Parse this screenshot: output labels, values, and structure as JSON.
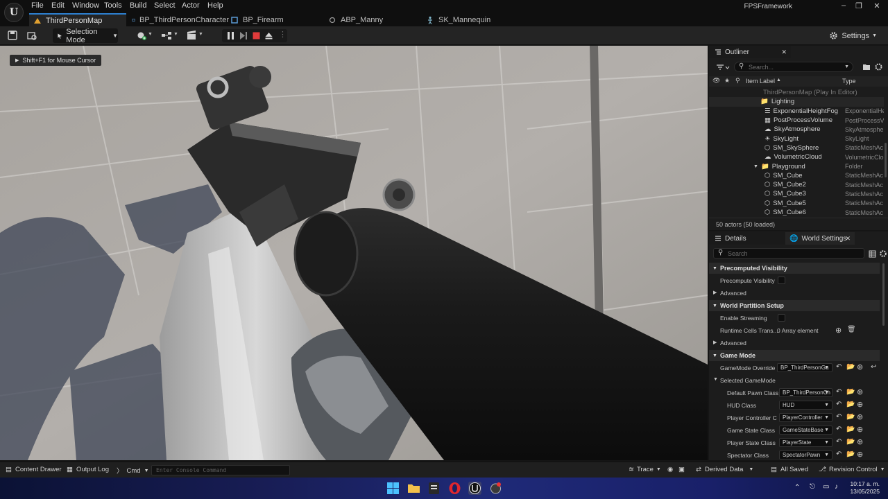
{
  "menu": [
    "File",
    "Edit",
    "Window",
    "Tools",
    "Build",
    "Select",
    "Actor",
    "Help"
  ],
  "tabs": [
    {
      "label": "ThirdPersonMap"
    },
    {
      "label": "BP_ThirdPersonCharacter"
    },
    {
      "label": "BP_Firearm"
    },
    {
      "label": "ABP_Manny"
    },
    {
      "label": "SK_Mannequin"
    }
  ],
  "project_name": "FPSFramework",
  "toolbar": {
    "selection_mode": "Selection Mode",
    "settings": "Settings"
  },
  "viewport": {
    "hint": "Shift+F1 for Mouse Cursor"
  },
  "outliner": {
    "title": "Outliner",
    "search_placeholder": "Search...",
    "col_label": "Item Label",
    "col_type": "Type",
    "map_row": "ThirdPersonMap (Play In Editor)",
    "rows": [
      {
        "label": "Lighting",
        "type": ""
      },
      {
        "label": "ExponentialHeightFog",
        "type": "ExponentialHe"
      },
      {
        "label": "PostProcessVolume",
        "type": "PostProcessV"
      },
      {
        "label": "SkyAtmosphere",
        "type": "SkyAtmosphe"
      },
      {
        "label": "SkyLight",
        "type": "SkyLight"
      },
      {
        "label": "SM_SkySphere",
        "type": "StaticMeshAc"
      },
      {
        "label": "VolumetricCloud",
        "type": "VolumetricClo"
      },
      {
        "label": "Playground",
        "type": "Folder"
      },
      {
        "label": "SM_Cube",
        "type": "StaticMeshAc"
      },
      {
        "label": "SM_Cube2",
        "type": "StaticMeshAc"
      },
      {
        "label": "SM_Cube3",
        "type": "StaticMeshAc"
      },
      {
        "label": "SM_Cube5",
        "type": "StaticMeshAc"
      },
      {
        "label": "SM_Cube6",
        "type": "StaticMeshAc"
      }
    ],
    "footer": "50 actors (50 loaded)"
  },
  "details": {
    "tab_details": "Details",
    "tab_world": "World Settings",
    "search_placeholder": "Search",
    "cat_precomputed": "Precomputed Visibility",
    "precompute_visibility": "Precompute Visibility",
    "advanced": "Advanced",
    "cat_world_partition": "World Partition Setup",
    "enable_streaming": "Enable Streaming",
    "runtime_cells": "Runtime Cells Trans...",
    "array_element": "0 Array element",
    "cat_game_mode": "Game Mode",
    "gamemode_override": "GameMode Override",
    "gamemode_value": "BP_ThirdPersonGa",
    "selected_gamemode": "Selected GameMode",
    "props": [
      {
        "label": "Default Pawn Class",
        "value": "BP_ThirdPersonCh"
      },
      {
        "label": "HUD Class",
        "value": "HUD"
      },
      {
        "label": "Player Controller C",
        "value": "PlayerController"
      },
      {
        "label": "Game State Class",
        "value": "GameStateBase"
      },
      {
        "label": "Player State Class",
        "value": "PlayerState"
      },
      {
        "label": "Spectator Class",
        "value": "SpectatorPawn"
      }
    ]
  },
  "status": {
    "content_drawer": "Content Drawer",
    "output_log": "Output Log",
    "cmd": "Cmd",
    "console_placeholder": "Enter Console Command",
    "trace": "Trace",
    "derived_data": "Derived Data",
    "all_saved": "All Saved",
    "revision_control": "Revision Control"
  },
  "taskbar": {
    "time": "10:17 a. m.",
    "date": "13/05/2025"
  }
}
